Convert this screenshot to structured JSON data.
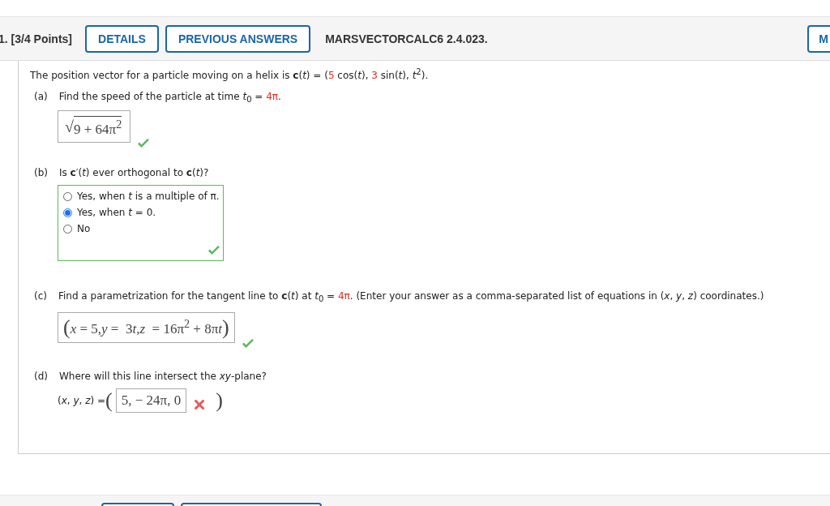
{
  "header": {
    "number": "1. [3/4 Points]",
    "buttons": [
      "DETAILS",
      "PREVIOUS ANSWERS"
    ],
    "code": "MARSVECTORCALC6 2.4.023.",
    "cut_button": "M"
  },
  "statement": [
    {
      "text": "The position vector for a particle moving on a helix is **c**(*t*) = (",
      "highlighted": false
    },
    {
      "text": "5",
      "highlighted": true
    },
    {
      "text": " cos(*t*), ",
      "highlighted": false
    },
    {
      "text": "3",
      "highlighted": true
    },
    {
      "text": " sin(*t*), *t*$^{2}$).",
      "highlighted": false
    }
  ],
  "parts": [
    {
      "kind": "expression",
      "label": "(a)",
      "prompt": [
        {
          "text": "Find the speed of the particle at time *t*$_{0}$ = ",
          "highlighted": false
        },
        {
          "text": "4π",
          "highlighted": true
        },
        {
          "text": ".",
          "highlighted": false
        }
      ],
      "radical": "√",
      "answer": "9 + 64π$^{2}$",
      "correct": true
    },
    {
      "kind": "choice",
      "label": "(b)",
      "prompt": [
        {
          "text": "Is **c**′(*t*) ever orthogonal to **c**(*t*)?",
          "highlighted": false
        }
      ],
      "options": [
        {
          "text": "Yes, when *t* is a multiple of π.",
          "selected": false
        },
        {
          "text": "Yes, when *t* = 0.",
          "selected": true
        },
        {
          "text": "No",
          "selected": false
        }
      ],
      "correct": true
    },
    {
      "kind": "equations",
      "label": "(c)",
      "prompt": [
        {
          "text": "Find a parametrization for the tangent line to **c**(*t*) at *t*$_{0}$ = ",
          "highlighted": false
        },
        {
          "text": "4π",
          "highlighted": true
        },
        {
          "text": ". (Enter your answer as a comma-separated list of equations in (*x*, *y*, *z*) coordinates.)",
          "highlighted": false
        }
      ],
      "open": "(",
      "answer": [
        {
          "text": "x",
          "italic": true
        },
        {
          "text": " = 5,",
          "italic": false
        },
        {
          "text": "y",
          "italic": true
        },
        {
          "text": " =  3",
          "italic": false
        },
        {
          "text": "t",
          "italic": true
        },
        {
          "text": ",",
          "italic": false
        },
        {
          "text": "z",
          "italic": true
        },
        {
          "text": "  = 16π$^{2}$ + 8π",
          "italic": false
        },
        {
          "text": "t",
          "italic": true
        }
      ],
      "close": ")",
      "correct": true
    },
    {
      "kind": "point",
      "label": "(d)",
      "prompt": [
        {
          "text": "Where will this line intersect the *xy*-plane?",
          "highlighted": false
        }
      ],
      "prefix": "(*x*, *y*, *z*) = ",
      "open": "(",
      "answer": "5, − 24π, 0",
      "close": ")",
      "correct": false
    }
  ]
}
